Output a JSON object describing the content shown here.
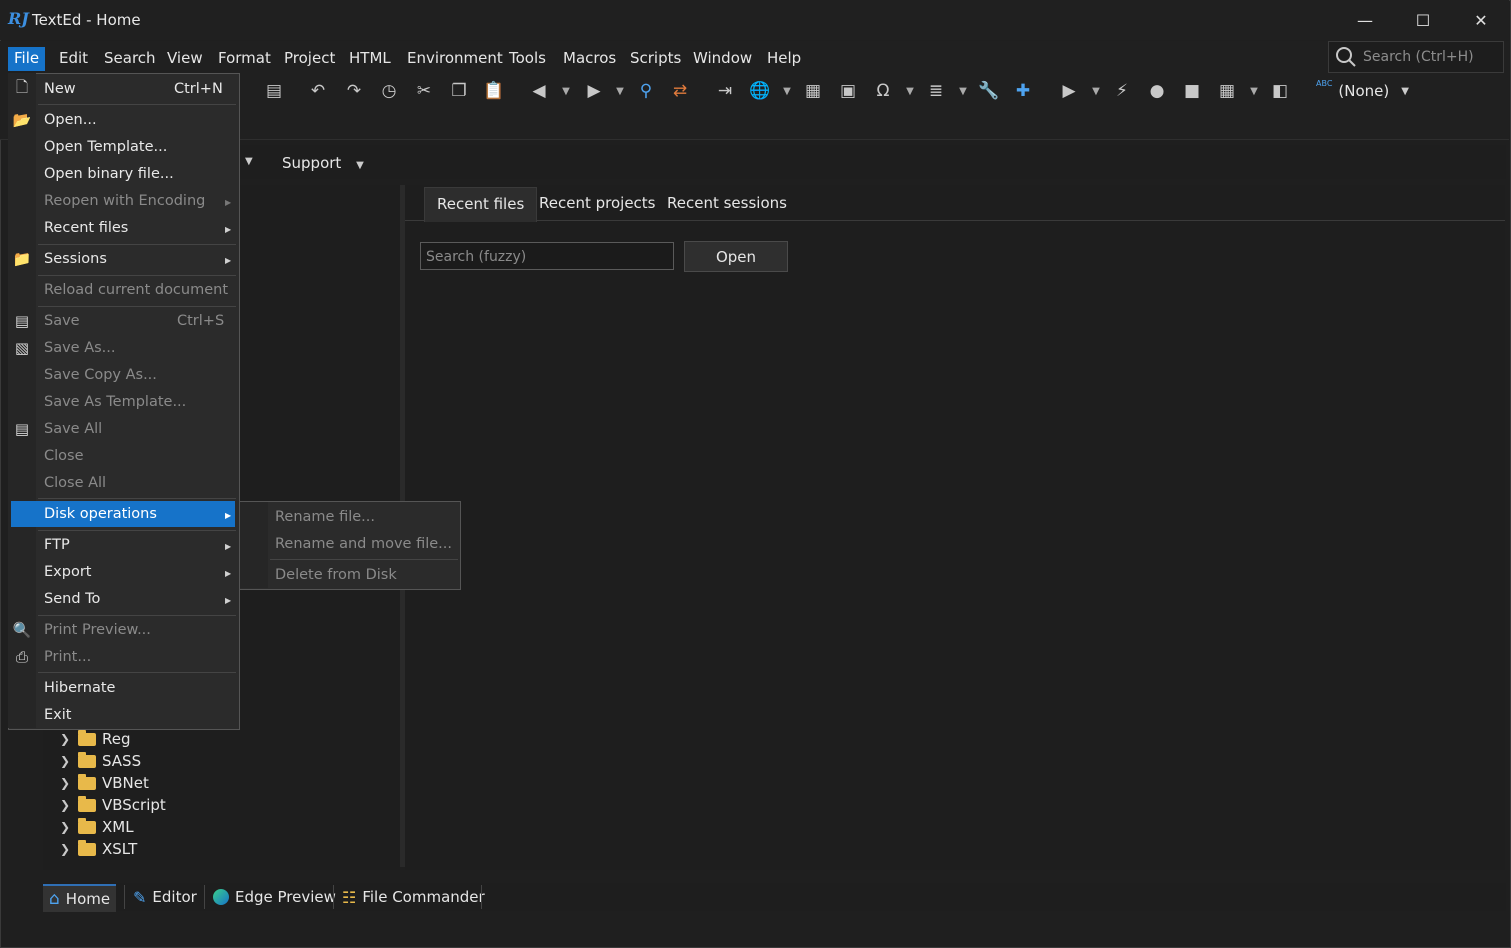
{
  "window": {
    "logo": "RJ",
    "title": "TextEd - Home",
    "controls": {
      "minimize": "—",
      "maximize": "☐",
      "close": "✕"
    }
  },
  "menubar": {
    "items": [
      {
        "label": "File"
      },
      {
        "label": "Edit"
      },
      {
        "label": "Search"
      },
      {
        "label": "View"
      },
      {
        "label": "Format"
      },
      {
        "label": "Project"
      },
      {
        "label": "HTML"
      },
      {
        "label": "Environment"
      },
      {
        "label": "Tools"
      },
      {
        "label": "Macros"
      },
      {
        "label": "Scripts"
      },
      {
        "label": "Window"
      },
      {
        "label": "Help"
      }
    ],
    "search_placeholder": "Search (Ctrl+H)"
  },
  "toolbar": {
    "language_label": "(None)",
    "spellcheck_label": "ABC"
  },
  "content": {
    "support_menu": "Support",
    "tabs": [
      {
        "label": "Recent files"
      },
      {
        "label": "Recent projects"
      },
      {
        "label": "Recent sessions"
      }
    ],
    "search_placeholder": "Search (fuzzy)",
    "open_button": "Open",
    "tree_items": [
      {
        "label": "Reg"
      },
      {
        "label": "SASS"
      },
      {
        "label": "VBNet"
      },
      {
        "label": "VBScript"
      },
      {
        "label": "XML"
      },
      {
        "label": "XSLT"
      }
    ]
  },
  "bottom_tabs": [
    {
      "label": "Home"
    },
    {
      "label": "Editor"
    },
    {
      "label": "Edge Preview"
    },
    {
      "label": "File Commander"
    }
  ],
  "file_menu": {
    "items": [
      {
        "label": "New",
        "shortcut": "Ctrl+N"
      },
      {
        "label": "Open..."
      },
      {
        "label": "Open Template..."
      },
      {
        "label": "Open binary file..."
      },
      {
        "label": "Reopen with Encoding"
      },
      {
        "label": "Recent files"
      },
      {
        "label": "Sessions"
      },
      {
        "label": "Reload current document"
      },
      {
        "label": "Save",
        "shortcut": "Ctrl+S"
      },
      {
        "label": "Save As..."
      },
      {
        "label": "Save Copy As..."
      },
      {
        "label": "Save As Template..."
      },
      {
        "label": "Save All"
      },
      {
        "label": "Close"
      },
      {
        "label": "Close All"
      },
      {
        "label": "Disk operations"
      },
      {
        "label": "FTP"
      },
      {
        "label": "Export"
      },
      {
        "label": "Send To"
      },
      {
        "label": "Print Preview..."
      },
      {
        "label": "Print..."
      },
      {
        "label": "Hibernate"
      },
      {
        "label": "Exit"
      }
    ]
  },
  "disk_submenu": {
    "items": [
      {
        "label": "Rename file..."
      },
      {
        "label": "Rename and move file..."
      },
      {
        "label": "Delete from Disk"
      }
    ]
  },
  "colors": {
    "accent": "#1673c9",
    "background": "#1f1f1f",
    "menu_bg": "#2b2b2b",
    "disabled_text": "#8a8a8a"
  }
}
